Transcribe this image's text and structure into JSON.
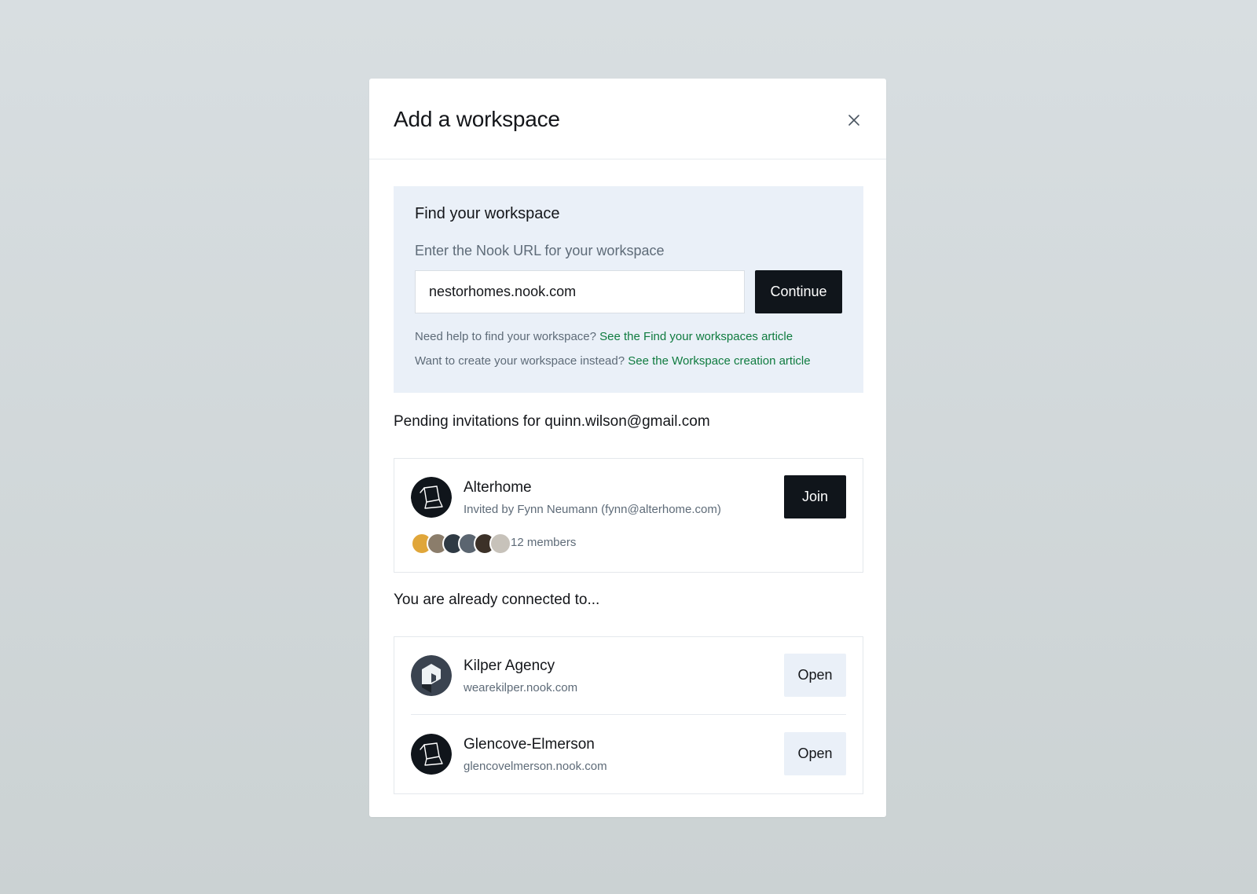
{
  "modal": {
    "title": "Add a workspace",
    "close_icon": "close-icon"
  },
  "find": {
    "title": "Find your workspace",
    "subtitle": "Enter the Nook URL for your workspace",
    "url_value": "nestorhomes.nook.com",
    "continue_label": "Continue",
    "help_text": "Need help to find your workspace?",
    "help_link": "See the Find your workspaces article",
    "create_text": "Want to create your workspace instead?",
    "create_link": "See the Workspace creation article"
  },
  "pending": {
    "heading": "Pending invitations for quinn.wilson@gmail.com",
    "invitations": [
      {
        "name": "Alterhome",
        "invited_by": "Invited by Fynn Neumann (fynn@alterhome.com)",
        "members_label": "12 members",
        "join_label": "Join",
        "logo_icon": "alterhome-logo-icon",
        "member_avatar_colors": [
          "#e0a63a",
          "#8b7d6b",
          "#2f3a44",
          "#5b6570",
          "#3c3128",
          "#c7c2ba"
        ]
      }
    ]
  },
  "connected": {
    "heading": "You are already connected to...",
    "workspaces": [
      {
        "name": "Kilper Agency",
        "url": "wearekilper.nook.com",
        "open_label": "Open",
        "logo_icon": "kilper-logo-icon"
      },
      {
        "name": "Glencove-Elmerson",
        "url": "glencovelmerson.nook.com",
        "open_label": "Open",
        "logo_icon": "glencove-logo-icon"
      }
    ]
  },
  "colors": {
    "primary_button": "#10151b",
    "link_green": "#0f7b3f",
    "panel_bg": "#eaf0f8",
    "muted_text": "#5e6b78"
  }
}
